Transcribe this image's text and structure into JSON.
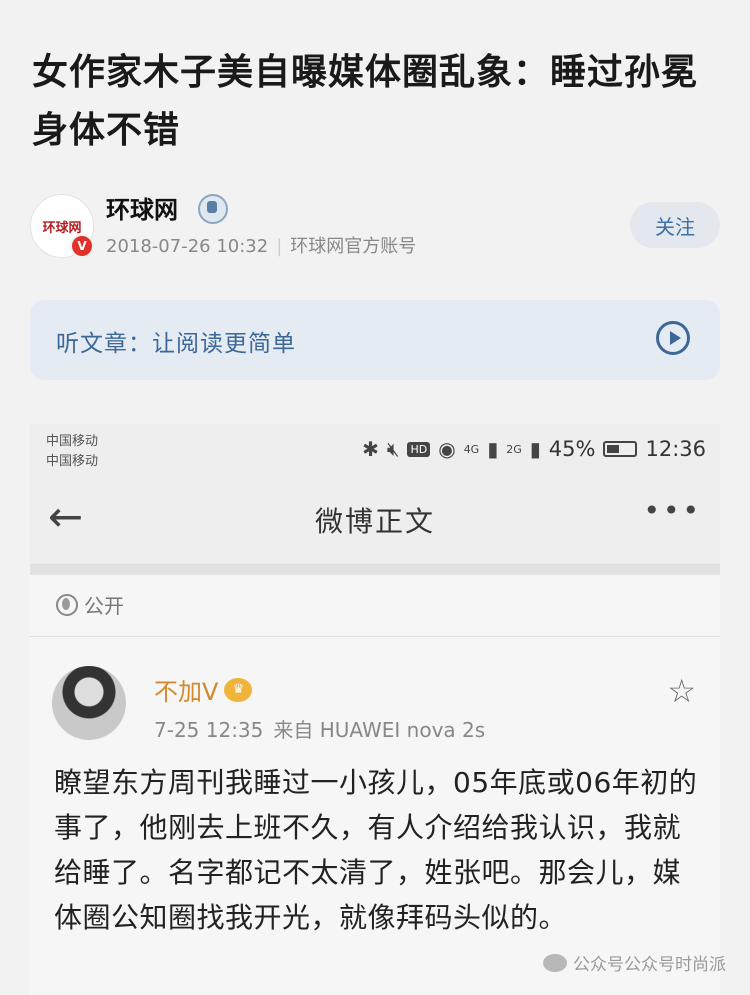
{
  "article": {
    "title": "女作家木子美自曝媒体圈乱象：睡过孙冕 身体不错"
  },
  "author": {
    "logo_text": "环球网",
    "verified_mark": "V",
    "name": "环球网",
    "date": "2018-07-26 10:32",
    "account_type": "环球网官方账号",
    "follow_label": "关注"
  },
  "listen": {
    "label": "听文章：让阅读更简单"
  },
  "screenshot": {
    "status_bar": {
      "carrier_1": "中国移动",
      "carrier_2": "中国移动",
      "hd": "HD",
      "net_1": "4G",
      "net_2": "2G",
      "battery": "45%",
      "time": "12:36"
    },
    "nav": {
      "title": "微博正文",
      "more": "•••"
    },
    "visibility": "公开",
    "post": {
      "username": "不加V",
      "time": "7-25 12:35",
      "source": "来自 HUAWEI nova 2s",
      "content": "瞭望东方周刊我睡过一小孩儿，05年底或06年初的事了，他刚去上班不久，有人介绍给我认识，我就给睡了。名字都记不太清了，姓张吧。那会儿，媒体圈公知圈找我开光，就像拜码头似的。"
    }
  },
  "watermark": {
    "text": "公众号公众号时尚派"
  }
}
